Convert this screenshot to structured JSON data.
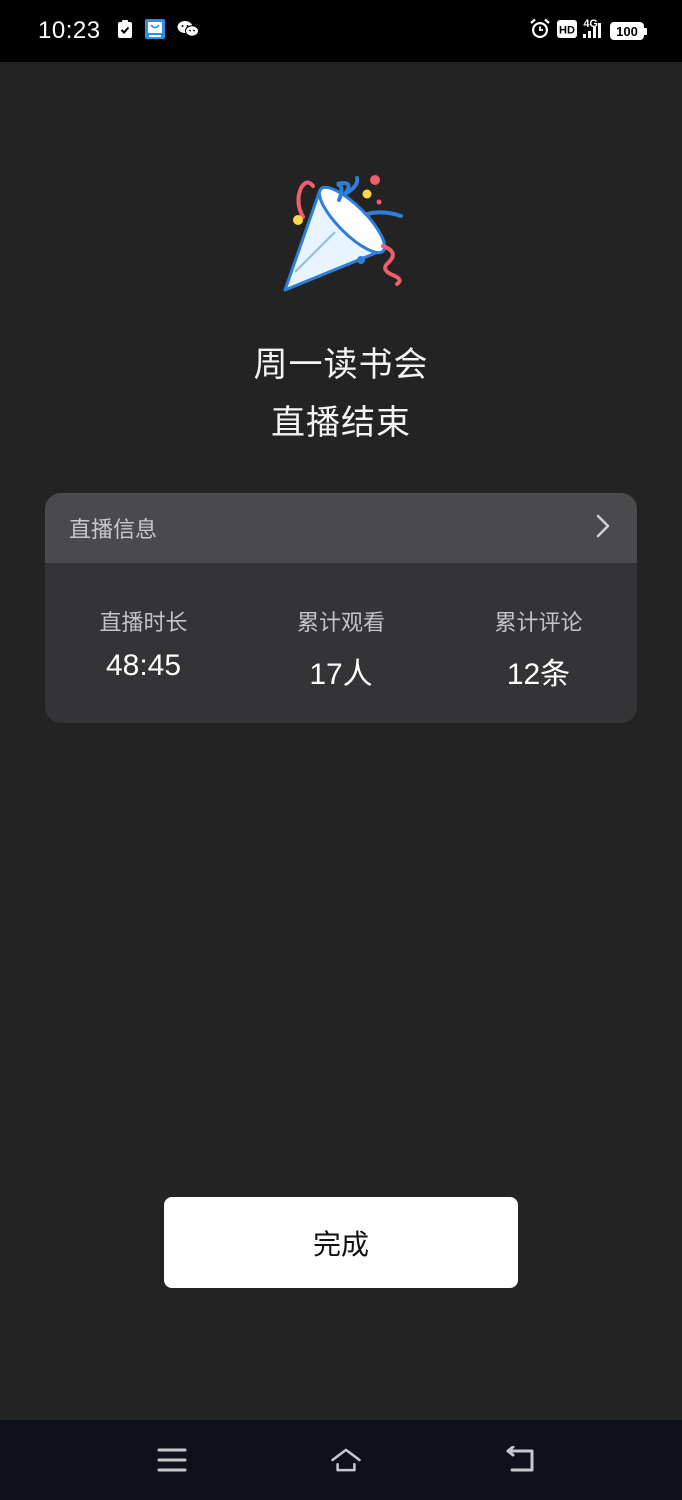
{
  "status_bar": {
    "time": "10:23",
    "network": "4G",
    "battery": "100",
    "icons": [
      "task-check-icon",
      "app-notification-icon",
      "wechat-icon",
      "alarm-icon",
      "hd-icon",
      "signal-icon",
      "battery-icon"
    ]
  },
  "hero": {
    "icon": "party-popper-icon",
    "title_line1": "周一读书会",
    "title_line2": "直播结束"
  },
  "info_card": {
    "header": "直播信息",
    "header_icon": "chevron-right-icon",
    "stats": [
      {
        "label": "直播时长",
        "value": "48:45"
      },
      {
        "label": "累计观看",
        "value": "17人"
      },
      {
        "label": "累计评论",
        "value": "12条"
      }
    ]
  },
  "actions": {
    "done_label": "完成"
  },
  "nav_bar": {
    "icons": [
      "menu-icon",
      "home-icon",
      "back-icon"
    ]
  },
  "colors": {
    "background": "#232324",
    "card": "#343436",
    "card_header": "#4a4a4c",
    "button": "#ffffff",
    "nav_bar": "#0f111a"
  }
}
